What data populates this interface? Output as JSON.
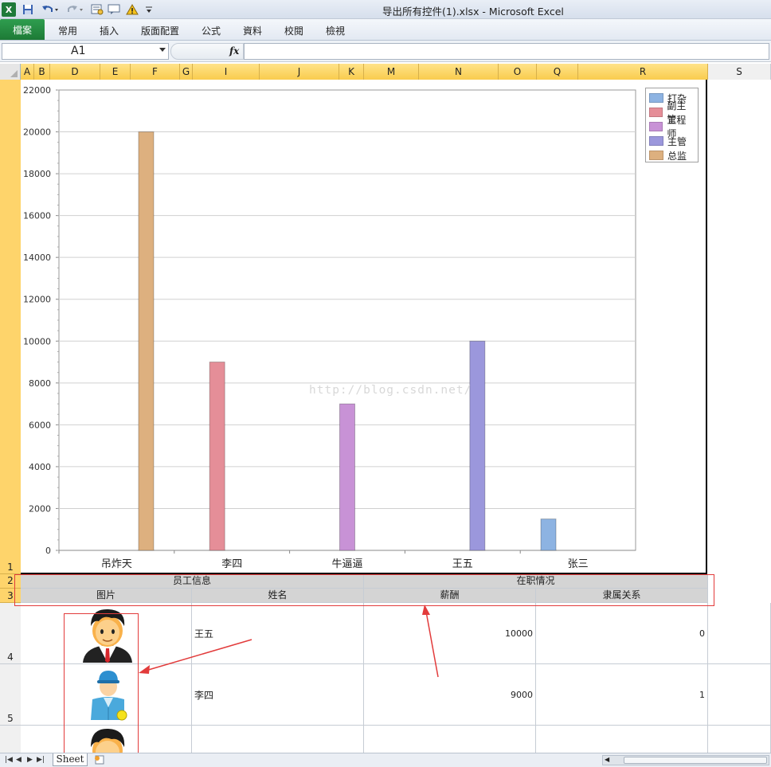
{
  "window": {
    "title": "导出所有控件(1).xlsx - Microsoft Excel",
    "app_logo": "X"
  },
  "ribbon": {
    "file_tab": "檔案",
    "tabs": [
      "常用",
      "插入",
      "版面配置",
      "公式",
      "資料",
      "校閱",
      "檢視"
    ]
  },
  "formula_bar": {
    "name_box": "A1",
    "fx": "fx",
    "formula": ""
  },
  "columns": [
    "A",
    "B",
    "D",
    "E",
    "F",
    "G",
    "I",
    "J",
    "K",
    "M",
    "N",
    "O",
    "Q",
    "R",
    "S"
  ],
  "rows": [
    "1",
    "2",
    "3",
    "4",
    "5"
  ],
  "chart_data": {
    "type": "bar",
    "categories": [
      "吊炸天",
      "李四",
      "牛逼逼",
      "王五",
      "张三"
    ],
    "series": [
      {
        "name": "打杂",
        "color": "#8db3e2",
        "values": [
          0,
          0,
          0,
          0,
          1500
        ]
      },
      {
        "name": "副主管",
        "color": "#e58e98",
        "values": [
          0,
          9000,
          0,
          0,
          0
        ]
      },
      {
        "name": "工程师",
        "color": "#c892d6",
        "values": [
          0,
          0,
          7000,
          0,
          0
        ]
      },
      {
        "name": "主管",
        "color": "#9b97dc",
        "values": [
          0,
          0,
          0,
          10000,
          0
        ]
      },
      {
        "name": "总监",
        "color": "#ddb07f",
        "values": [
          20000,
          0,
          0,
          0,
          0
        ]
      }
    ],
    "ylim": [
      0,
      22000
    ],
    "yticks": [
      "0",
      "2000",
      "4000",
      "6000",
      "8000",
      "10000",
      "12000",
      "14000",
      "16000",
      "18000",
      "20000",
      "22000"
    ],
    "grid": true,
    "legend_position": "top-right"
  },
  "watermark": "http://blog.csdn.net/",
  "table": {
    "group_headers": [
      "员工信息",
      "在职情况"
    ],
    "headers": [
      "图片",
      "姓名",
      "薪酬",
      "隶属关系"
    ],
    "rows": [
      {
        "name": "王五",
        "salary": "10000",
        "relation": "0"
      },
      {
        "name": "李四",
        "salary": "9000",
        "relation": "1"
      }
    ]
  },
  "sheet_tabs": {
    "active": "Sheet"
  }
}
